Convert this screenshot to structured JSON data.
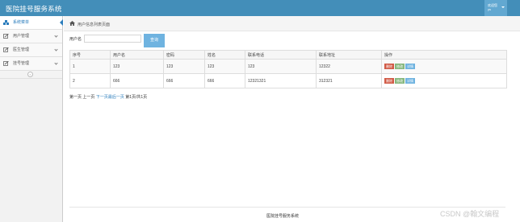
{
  "app": {
    "title": "医院挂号服务系统",
    "user_label": "欢迎您",
    "user_name": "ys"
  },
  "sidebar": {
    "items": [
      {
        "label": "系统菜单",
        "icon": "dashboard-icon",
        "active": true
      },
      {
        "label": "用户管理",
        "icon": "edit-icon",
        "active": false
      },
      {
        "label": "医生管理",
        "icon": "edit-icon",
        "active": false
      },
      {
        "label": "挂号管理",
        "icon": "edit-icon",
        "active": false
      }
    ],
    "collapse_glyph": "«"
  },
  "breadcrumb": {
    "text": "用户信息列表页面",
    "icon": "home-icon"
  },
  "search": {
    "label": "用户名",
    "value": "",
    "button": "查询"
  },
  "table": {
    "columns": [
      "序号",
      "用户名",
      "密码",
      "姓名",
      "联系电话",
      "联系地址",
      "操作"
    ],
    "rows": [
      {
        "id": "1",
        "username": "123",
        "password": "123",
        "name": "123",
        "phone": "123",
        "address": "12322"
      },
      {
        "id": "2",
        "username": "666",
        "password": "666",
        "name": "666",
        "phone": "12321321",
        "address": "312321"
      }
    ],
    "actions": {
      "delete": "删除",
      "edit": "修改",
      "detail": "详情"
    }
  },
  "pager": {
    "first": "第一页",
    "prev": "上一页",
    "next": "下一页",
    "last": "最后一页",
    "info": "第1页/共1页"
  },
  "footer": {
    "text": "医院挂号服务系统"
  },
  "watermark": "CSDN @翰文编程",
  "colors": {
    "header": "#438eb9",
    "delete": "#d15b47",
    "edit": "#87b87f",
    "detail": "#6fb3e0"
  }
}
